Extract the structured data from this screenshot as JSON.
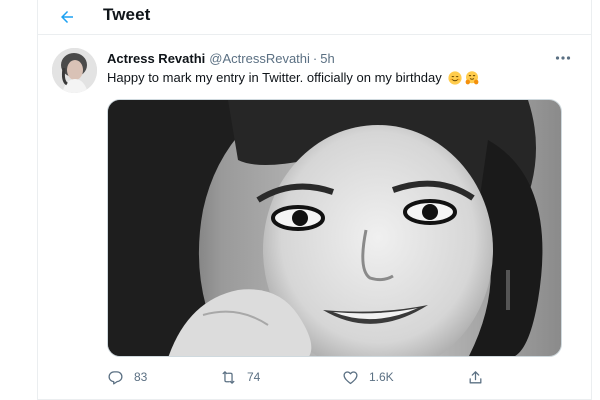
{
  "header": {
    "title": "Tweet",
    "back_icon": "arrow-left-icon"
  },
  "tweet": {
    "display_name": "Actress Revathi",
    "handle": "@ActressRevathi",
    "separator": "·",
    "time": "5h",
    "text": "Happy to mark my entry in Twitter. officially on my birthday",
    "emojis": [
      "smiling-face-with-smiling-eyes-emoji",
      "hugging-face-emoji"
    ],
    "more_icon": "more-horizontal-icon",
    "media_alt": "Black and white portrait photo"
  },
  "actions": {
    "reply": {
      "icon": "reply-icon",
      "count": "83"
    },
    "retweet": {
      "icon": "retweet-icon",
      "count": "74"
    },
    "like": {
      "icon": "heart-icon",
      "count": "1.6K"
    },
    "share": {
      "icon": "share-icon",
      "count": ""
    }
  },
  "colors": {
    "accent": "#1da1f2",
    "secondary_text": "#5b7083",
    "primary_text": "#0f1419",
    "border": "#ebeef0"
  }
}
